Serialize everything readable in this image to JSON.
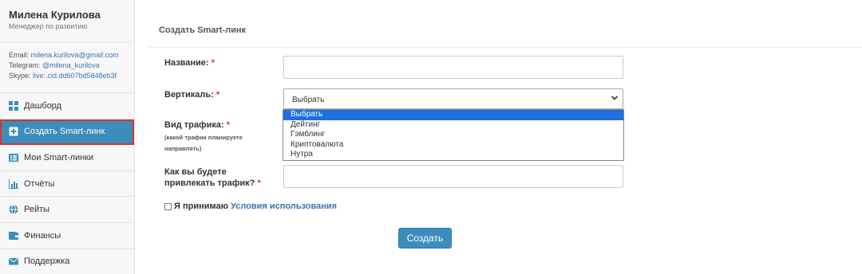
{
  "profile": {
    "name": "Милена Курилова",
    "role": "Менеджер по развитию"
  },
  "contacts": {
    "email_label": "Email:",
    "email": "milena.kurilova@gmail.com",
    "telegram_label": "Telegram:",
    "telegram": "@milena_kurilova",
    "skype_label": "Skype:",
    "skype": "live:.cid.dd607bd5848eb3f"
  },
  "sidebar": {
    "items": [
      {
        "label": "Дашборд",
        "icon": "dashboard-icon"
      },
      {
        "label": "Создать Smart-линк",
        "icon": "plus-square-icon",
        "active": true
      },
      {
        "label": "Мои Smart-линки",
        "icon": "list-icon"
      },
      {
        "label": "Отчёты",
        "icon": "bar-chart-icon"
      },
      {
        "label": "Рейты",
        "icon": "globe-icon"
      },
      {
        "label": "Финансы",
        "icon": "wallet-icon"
      },
      {
        "label": "Поддержка",
        "icon": "envelope-icon"
      }
    ]
  },
  "form": {
    "title": "Создать Smart-линк",
    "name_label": "Название:",
    "vertical_label": "Вертикаль:",
    "traffic_label": "Вид трафика:",
    "traffic_hint_1": "(какой трафик планируете",
    "traffic_hint_2": "направлять)",
    "attract_label_1": "Как вы будете",
    "attract_label_2": "привлекать трафик?",
    "required_mark": "*",
    "select_value": "Выбрать",
    "options": [
      "Выбрать",
      "Дейтинг",
      "Гэмблинг",
      "Криптовалюта",
      "Нутра"
    ],
    "terms_text": "Я принимаю",
    "terms_link": "Условия использования",
    "submit_label": "Создать"
  },
  "colors": {
    "accent": "#3c8dbc",
    "highlight_border": "#d9342b",
    "dropdown_selected": "#1e6fe0",
    "link": "#3b74b3"
  }
}
